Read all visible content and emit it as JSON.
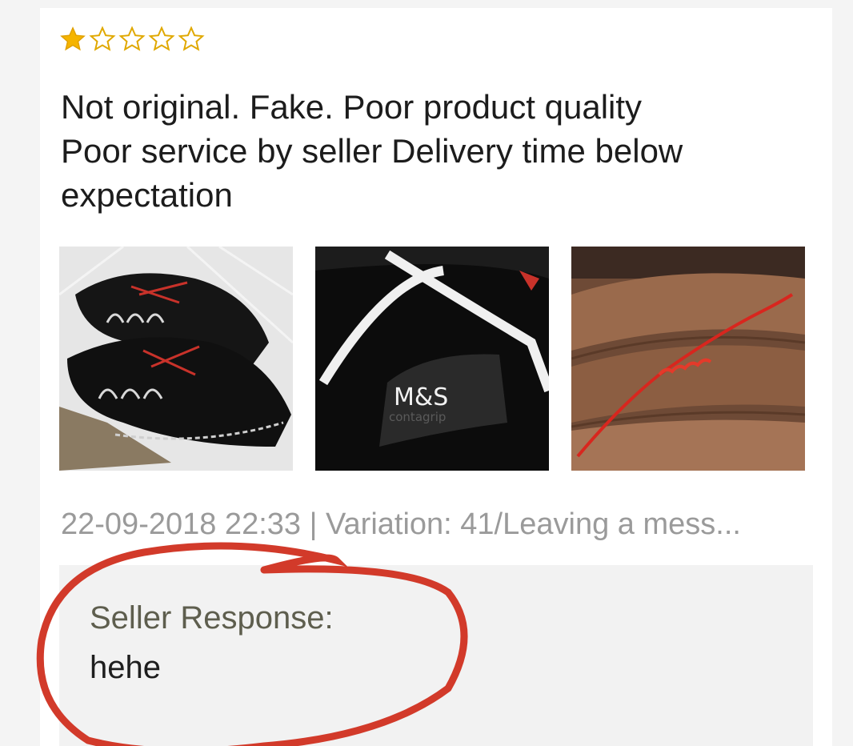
{
  "review": {
    "rating": 1,
    "max_rating": 5,
    "star_filled_color": "#f5b400",
    "star_empty_color": "#e0a800",
    "text_lines": [
      "Not original. Fake. Poor product quality",
      "Poor service by seller  Delivery time below",
      "expectation"
    ],
    "photos": [
      {
        "icon": "shoes-photo"
      },
      {
        "icon": "shoe-logo-photo",
        "logo_text": "M&S",
        "logo_subtext": "contagrip"
      },
      {
        "icon": "thread-photo"
      }
    ],
    "meta": "22-09-2018 22:33 | Variation: 41/Leaving a mess..."
  },
  "seller_response": {
    "label": "Seller Response:",
    "text": "hehe"
  },
  "annotation": {
    "circle_color": "#d23a2a"
  }
}
